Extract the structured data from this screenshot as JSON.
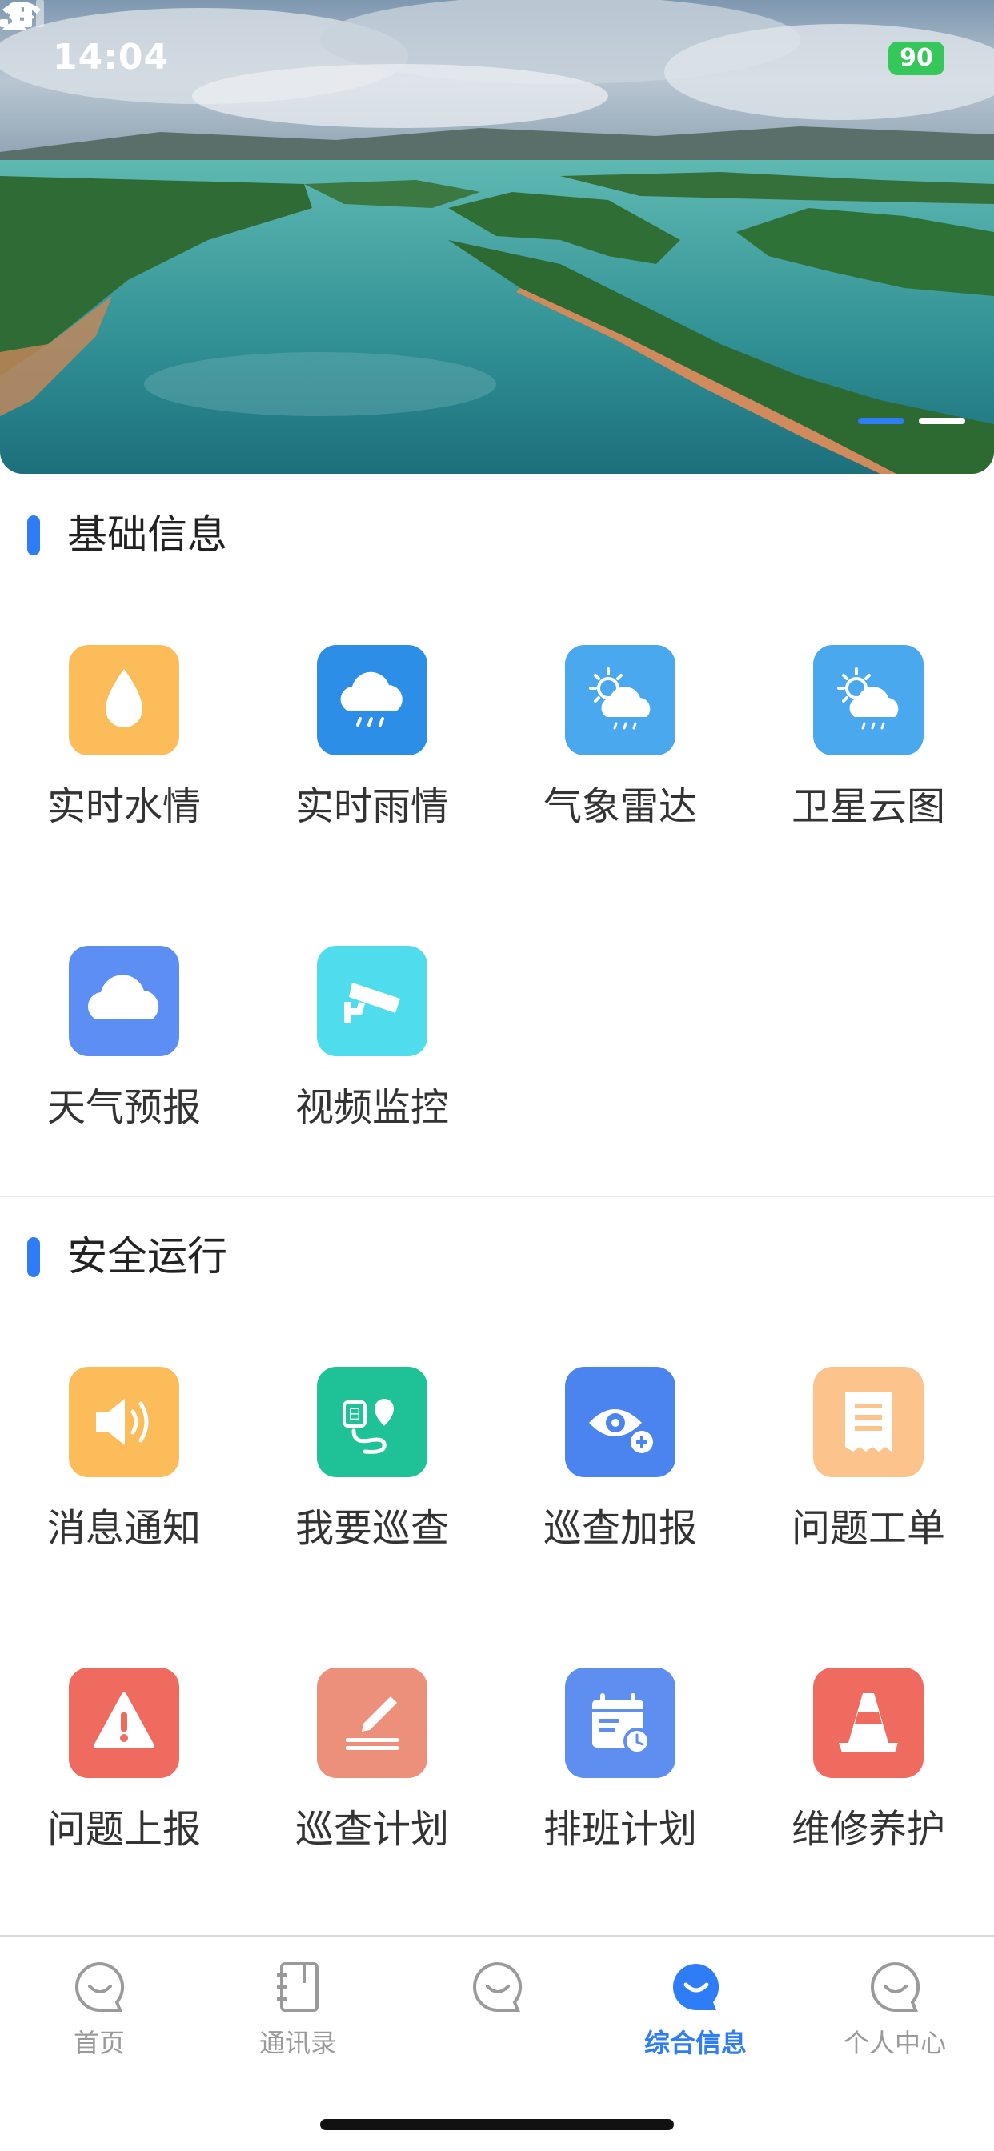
{
  "status_bar": {
    "time": "14:04",
    "battery": "90"
  },
  "banner": {
    "active_index": 1,
    "count": 2
  },
  "sections": [
    {
      "title": "基础信息",
      "items": [
        {
          "label": "实时水情",
          "icon": "water-drop-icon",
          "color": "#fcbc5a"
        },
        {
          "label": "实时雨情",
          "icon": "rain-cloud-icon",
          "color": "#2d8ee8"
        },
        {
          "label": "气象雷达",
          "icon": "sun-cloud-rain-icon",
          "color": "#4aa8ef"
        },
        {
          "label": "卫星云图",
          "icon": "sun-cloud-rain-icon",
          "color": "#4aa8ef"
        },
        {
          "label": "天气预报",
          "icon": "cloud-icon",
          "color": "#5c8ef3"
        },
        {
          "label": "视频监控",
          "icon": "security-camera-icon",
          "color": "#4fdcec"
        }
      ]
    },
    {
      "title": "安全运行",
      "items": [
        {
          "label": "消息通知",
          "icon": "speaker-icon",
          "color": "#fcbc5a"
        },
        {
          "label": "我要巡查",
          "icon": "patrol-route-icon",
          "color": "#1fc197"
        },
        {
          "label": "巡查加报",
          "icon": "eye-plus-icon",
          "color": "#4b84ef"
        },
        {
          "label": "问题工单",
          "icon": "receipt-icon",
          "color": "#fcc38d"
        },
        {
          "label": "问题上报",
          "icon": "warning-icon",
          "color": "#ef6b5f"
        },
        {
          "label": "巡查计划",
          "icon": "pen-icon",
          "color": "#ec907c"
        },
        {
          "label": "排班计划",
          "icon": "calendar-clock-icon",
          "color": "#5e8ef0"
        },
        {
          "label": "维修养护",
          "icon": "traffic-cone-icon",
          "color": "#ef6b5f"
        }
      ]
    }
  ],
  "tabbar": {
    "items": [
      {
        "label": "首页",
        "icon": "smile-bubble-icon"
      },
      {
        "label": "通讯录",
        "icon": "contacts-book-icon"
      },
      {
        "label": "",
        "icon": "smile-bubble-icon"
      },
      {
        "label": "综合信息",
        "icon": "smile-bubble-icon"
      },
      {
        "label": "个人中心",
        "icon": "smile-bubble-icon"
      }
    ],
    "active_index": 3,
    "active_color": "#2f7df6",
    "inactive_color": "#9a9a9a"
  }
}
